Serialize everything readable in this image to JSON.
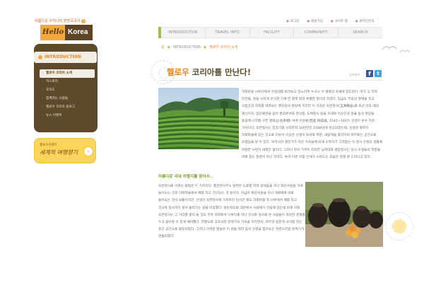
{
  "utility_links": [
    {
      "label": "로그인"
    },
    {
      "label": "회원가입"
    },
    {
      "label": "사이트 맵"
    },
    {
      "label": "온라인문의"
    }
  ],
  "logo": {
    "tagline": "아름다운 우리나라 방방곡곡의",
    "badge": "i",
    "word1": "Hello",
    "word2": "Korea"
  },
  "gnb": [
    {
      "label": "INTRODUCTION"
    },
    {
      "label": "TRAVEL  INFO"
    },
    {
      "label": "FACILITY"
    },
    {
      "label": "COMMUNITY"
    },
    {
      "label": "SEARCH"
    }
  ],
  "sidebar": {
    "heading": "INTRODUCTION",
    "items": [
      {
        "label": "헬로우 코리아 소개"
      },
      {
        "label": "히스토리"
      },
      {
        "label": "조직도"
      },
      {
        "label": "함께하는 사람들"
      },
      {
        "label": "헬로우 코리아 블로그"
      },
      {
        "label": "뉴스 이벤트"
      }
    ]
  },
  "banner": {
    "line1": "헬로우이벤트",
    "line2": "세계의 여행향기",
    "go": "›"
  },
  "breadcrumb": {
    "home": "홈",
    "sep1": "◉",
    "level1": "INTRODUCTION",
    "sep2": "◉",
    "current": "헬로우 코리아 소개"
  },
  "headline": {
    "highlight": "헬로우",
    "rest": " 코리아를 만난다!"
  },
  "share": {
    "label": "공유하기",
    "facebook": "f",
    "twitter": "t"
  },
  "content": {
    "para1": "하회마을 나루터에서 부용대를 바라보고 있노라면 누구나 이 절벽의 위세에 압도된다. 마치 고 지역 터전을, 살을 시리게 은거한 기세 한 절벽 밖의 특별한 일이라 하겠다. 임금도 부용의 절벽을 지고 낙동강과 하회를 바라보는 명당중의 명당에 지리한 이 가옥은 옥연정사(玉淵精舍)로 조선 선조 때의 명신이자, 임진왜란을 맞아 병조판서와 영의정, 도체찰사 등을 지내며 이순신과 권율 등의 명장을 등용해 나라를 구한 명재상(名宰相) 서애 유성룡(西厓 柳成龍, 1542~1607) 선생이 손수 지은 거처이다. 옥연정사는 집짓기를 시작한지 10년만인 1586년에 완공되었는데, 선생의 절학이 하회마을에 있는 것으로 미루어 이곳은 선생이 독서와 학문, 내방객을 맞이하며 머무르는 공간으로 쓰였음을 알 수 있다. 우리나라 명문가가 지은 가옥들에 비해 소박하기 그지없는 이 정사 선생의 생활에 아련한 시련이 대해진 셈이다. 그러나 정사 가까이 자리한 능파대와 겸암정사는 당시 유생들의 학문을 바로 찾는 풍경이 아닌 것이다. 특히 이른 아침 안개가 스며드는 모습은 정말 잘 드러나고 있다.",
    "sub_title": "아름다운 국내 여행지를 찾아서..",
    "para2": "옥연정사로 이르는 방법은 두 가지이다. 풍천면사무소 방면은 도로를 따라 갈대숲을 지나 화천서원을 거쳐 들어오는 것과 하회마을에서 배를 타고 건너오는 것 등이다. 지금은 화천서원을 지나 대로에로 바로 들어오는 것이 보통이지만, 선생이 옥연정사에 거처하던 당시만 해도 하회마을 쪽 나루에서 배를 타고 건너와 정사까지 걸어 올라가는 길을 이용했다. 일반적으로 대문에서 사랑채가 건립해 있는데 비해 하회 옥연정사는 그 거리를 멀리 둘 것도 주목 하회에서 나루터를 지나 건너와 정사로 온 사람들이 적당한 경계를 두고 맞이할 수 있게 배려했다. 한편으로 고즈넉한 분위기의 가옥을 지키면서, 외부의 방문객 사이를 잇는 중간 공간으로 활용되었다. 그러나 가까운 벗들은 이 길을 따라 잠시 선생을 찾아오는 자연스러운 분위기가 연출되었다."
  },
  "colors": {
    "brand_brown": "#5d4426",
    "accent_orange": "#e2861f",
    "accent_green": "#9cc24b",
    "logo_orange": "#f2a93b",
    "banner_yellow": "#fbd45a"
  }
}
